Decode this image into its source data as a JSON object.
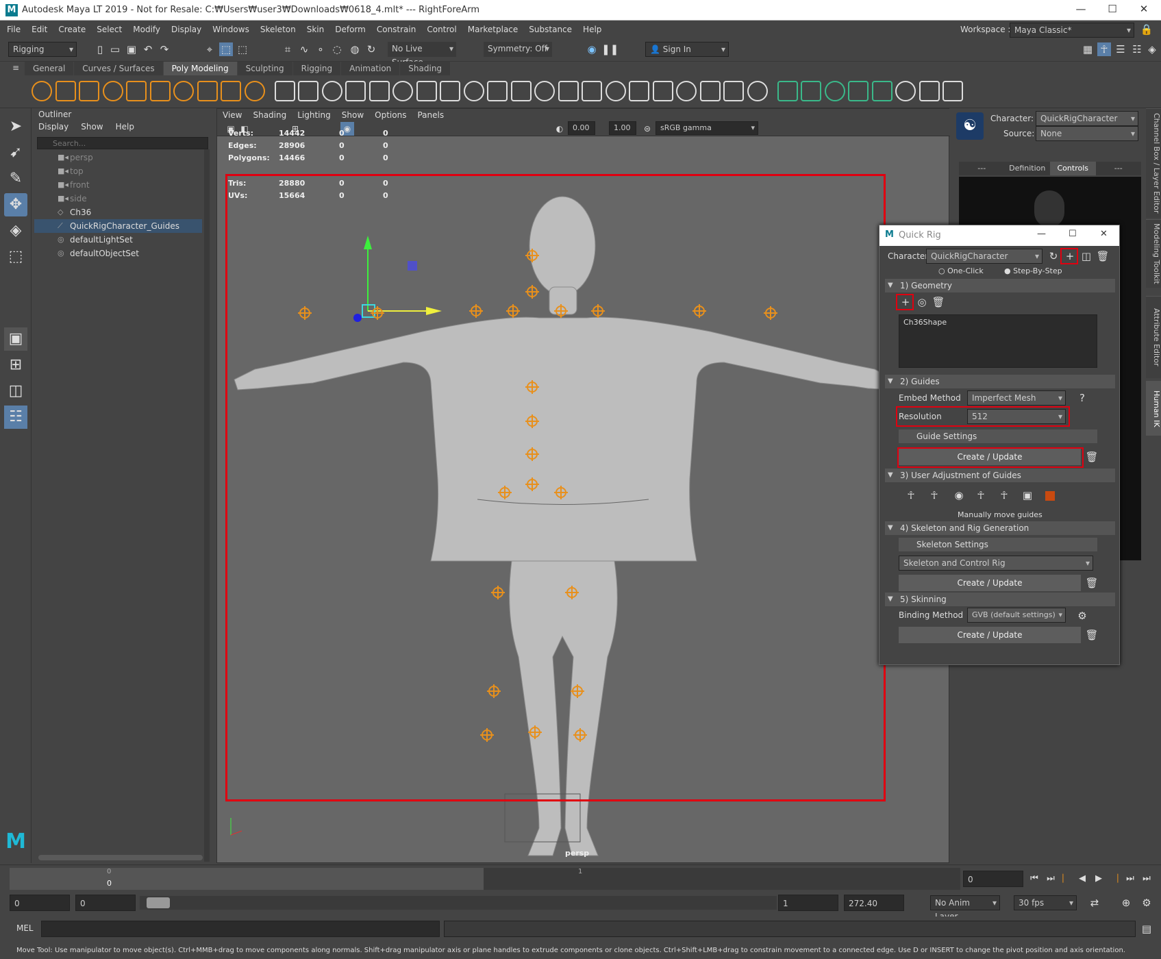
{
  "window": {
    "title": "Autodesk Maya LT 2019 - Not for Resale: C:₩Users₩user3₩Downloads₩0618_4.mlt*   ---   RightForeArm",
    "logo": "M"
  },
  "menu": [
    "File",
    "Edit",
    "Create",
    "Select",
    "Modify",
    "Display",
    "Windows",
    "Skeleton",
    "Skin",
    "Deform",
    "Constrain",
    "Control",
    "Marketplace",
    "Substance",
    "Help"
  ],
  "workspace": {
    "label": "Workspace :",
    "value": "Maya Classic*"
  },
  "toolbar": {
    "menuset": "Rigging",
    "live_surface": "No Live Surface",
    "symmetry": "Symmetry: Off",
    "signin": "Sign In"
  },
  "shelf_tabs": [
    "General",
    "Curves / Surfaces",
    "Poly Modeling",
    "Sculpting",
    "Rigging",
    "Animation",
    "Shading"
  ],
  "shelf_active": "Poly Modeling",
  "outliner": {
    "title": "Outliner",
    "menu": [
      "Display",
      "Show",
      "Help"
    ],
    "search_placeholder": "Search...",
    "items": [
      {
        "label": "persp",
        "icon": "camera-icon",
        "dim": true
      },
      {
        "label": "top",
        "icon": "camera-icon",
        "dim": true
      },
      {
        "label": "front",
        "icon": "camera-icon",
        "dim": true
      },
      {
        "label": "side",
        "icon": "camera-icon",
        "dim": true
      },
      {
        "label": "Ch36",
        "icon": "mesh-icon",
        "dim": false
      },
      {
        "label": "QuickRigCharacter_Guides",
        "icon": "guides-icon",
        "dim": false,
        "selected": true
      },
      {
        "label": "defaultLightSet",
        "icon": "set-icon",
        "dim": false
      },
      {
        "label": "defaultObjectSet",
        "icon": "set-icon",
        "dim": false
      }
    ]
  },
  "viewport": {
    "menu": [
      "View",
      "Shading",
      "Lighting",
      "Show",
      "Options",
      "Panels"
    ],
    "exposure": "0.00",
    "gamma": "1.00",
    "colorspace": "sRGB gamma",
    "camera": "persp",
    "stats": [
      {
        "label": "Verts:",
        "a": "14442",
        "b": "0",
        "c": "0"
      },
      {
        "label": "Edges:",
        "a": "28906",
        "b": "0",
        "c": "0"
      },
      {
        "label": "Polygons:",
        "a": "14466",
        "b": "0",
        "c": "0"
      },
      {
        "label": "Tris:",
        "a": "28880",
        "b": "0",
        "c": "0"
      },
      {
        "label": "UVs:",
        "a": "15664",
        "b": "0",
        "c": "0"
      }
    ]
  },
  "hik": {
    "character_label": "Character:",
    "character": "QuickRigCharacter",
    "source_label": "Source:",
    "source": "None",
    "tabs": [
      "---",
      "Definition",
      "Controls",
      "---"
    ],
    "active_tab": "Controls"
  },
  "quick_rig": {
    "title": "Quick Rig",
    "character_label": "Character:",
    "character": "QuickRigCharacter",
    "mode_one_click": "One-Click",
    "mode_step": "Step-By-Step",
    "s1": "1) Geometry",
    "geometry_item": "Ch36Shape",
    "s2": "2) Guides",
    "embed_label": "Embed Method",
    "embed_value": "Imperfect Mesh",
    "resolution_label": "Resolution",
    "resolution_value": "512",
    "guide_settings": "Guide Settings",
    "create_update": "Create / Update",
    "s3": "3) User Adjustment of Guides",
    "manual": "Manually move guides",
    "s4": "4) Skeleton and Rig Generation",
    "skeleton_settings": "Skeleton Settings",
    "skeleton_option": "Skeleton and Control Rig",
    "s5": "5) Skinning",
    "binding_label": "Binding Method",
    "binding_value": "GVB (default settings)"
  },
  "side_tabs": [
    "Channel Box / Layer Editor",
    "Modeling Toolkit",
    "Attribute Editor",
    "Human IK"
  ],
  "timeline": {
    "start_tick": "0",
    "start_label": "0",
    "mid_tick": "1",
    "current": "0"
  },
  "range": {
    "start": "0",
    "anim_start": "0",
    "end": "1",
    "anim_end": "272.40",
    "layer": "No Anim Layer",
    "fps": "30 fps"
  },
  "mel": {
    "label": "MEL"
  },
  "help_line": "Move Tool: Use manipulator to move object(s). Ctrl+MMB+drag to move components along normals. Shift+drag manipulator axis or plane handles to extrude components or clone objects. Ctrl+Shift+LMB+drag to constrain movement to a connected edge. Use D or INSERT to change the pivot position and axis orientation."
}
